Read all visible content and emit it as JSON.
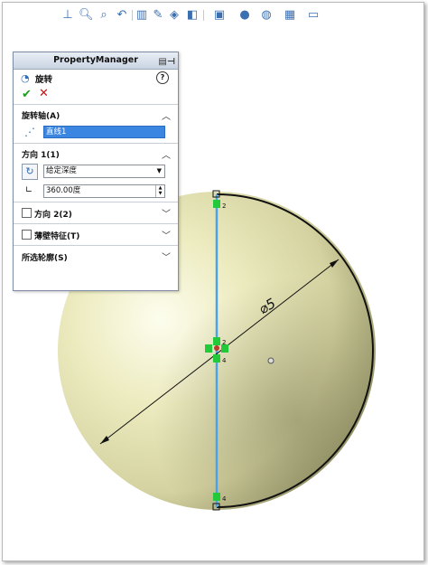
{
  "toolbar": {
    "icons": [
      "view-orientation-icon",
      "zoom-to-fit-icon",
      "zoom-to-area-icon",
      "previous-view-icon",
      "section-view-icon",
      "dynamic-annotation-icon",
      "view-orientation-cube-icon",
      "display-style-icon",
      "hide-show-items-icon",
      "edit-appearance-icon",
      "apply-scene-icon",
      "view-settings-icon"
    ]
  },
  "property_manager": {
    "header": "PropertyManager",
    "feature_title": "旋转",
    "help_symbol": "?",
    "ok_symbol": "✔",
    "cancel_symbol": "✕",
    "axis_group": {
      "title": "旋转轴(A)",
      "axis_value": "直线1"
    },
    "direction1_group": {
      "title": "方向 1(1)",
      "end_condition": "给定深度",
      "angle": "360.00度"
    },
    "direction2": {
      "label": "方向 2(2)",
      "checked": false
    },
    "thin_feature": {
      "label": "薄壁特征(T)",
      "checked": false
    },
    "selected_contours": {
      "label": "所选轮廓(S)"
    }
  },
  "sketch": {
    "dimension_label": "⌀5",
    "point_labels": [
      "2",
      "2",
      "4",
      "4"
    ]
  },
  "colors": {
    "sphere_light": "#fbfbe6",
    "sphere_mid": "#e9e7b6",
    "sphere_dark": "#7a7950",
    "sketch_line": "#4aa3e8",
    "constraint_green": "#22c93a",
    "selection_blue": "#3a86e0"
  }
}
